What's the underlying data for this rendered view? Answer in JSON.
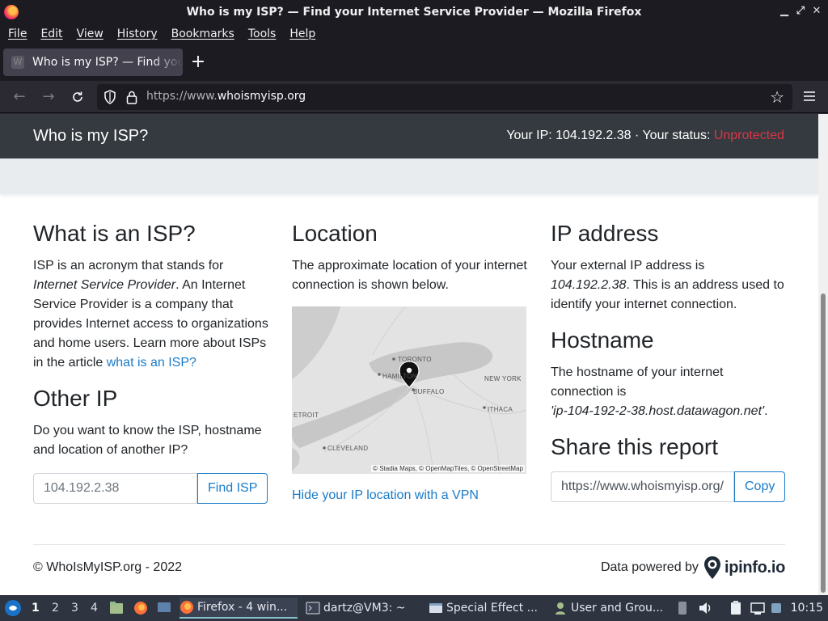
{
  "window": {
    "title": "Who is my ISP? — Find your Internet Service Provider — Mozilla Firefox",
    "controls": [
      "minimize",
      "restore",
      "close"
    ]
  },
  "menubar": {
    "items": [
      "File",
      "Edit",
      "View",
      "History",
      "Bookmarks",
      "Tools",
      "Help"
    ]
  },
  "tabs": [
    {
      "label": "Who is my ISP? — Find your Internet Service Provider",
      "favicon": "W"
    }
  ],
  "newtab_label": "+",
  "navbar": {
    "url_prefix": "https://www.",
    "url_domain": "whoismyisp.org"
  },
  "site": {
    "brand": "Who is my ISP?",
    "status_prefix": "Your IP: 104.192.2.38 · Your status: ",
    "status_value": "Unprotected",
    "status_color": "#dc3545"
  },
  "isp_section": {
    "title": "What is an ISP?",
    "text_a": "ISP is an acronym that stands for ",
    "text_em": "Internet Service Provider",
    "text_b": ". An Internet Service Provider is a company that provides Internet access to organizations and home users. Learn more about ISPs in the article ",
    "link": "what is an ISP?"
  },
  "other_ip": {
    "title": "Other IP",
    "text": "Do you want to know the ISP, hostname and location of another IP?",
    "placeholder": "104.192.2.38",
    "button": "Find ISP"
  },
  "location": {
    "title": "Location",
    "text": "The approximate location of your internet connection is shown below.",
    "map_labels": {
      "toronto": "TORONTO",
      "hamilton": "HAMILTON",
      "buffalo": "BUFFALO",
      "new_york": "NEW YORK",
      "ithaca": "ITHACA",
      "detroit": "ETROIT",
      "cleveland": "CLEVELAND"
    },
    "map_attribution": "© Stadia Maps, © OpenMapTiles, © OpenStreetMap",
    "vpn_link": "Hide your IP location with a VPN"
  },
  "ip_address": {
    "title": "IP address",
    "text_a": "Your external IP address is ",
    "ip": "104.192.2.38",
    "text_b": ". This is an address used to identify your internet connection."
  },
  "hostname": {
    "title": "Hostname",
    "text": "The hostname of your internet connection is",
    "value": "'ip-104-192-2-38.host.datawagon.net'",
    "text_end": "."
  },
  "share": {
    "title": "Share this report",
    "url": "https://www.whoismyisp.org/",
    "button": "Copy"
  },
  "footer": {
    "copyright": "© WhoIsMyISP.org - 2022",
    "powered_by": "Data powered by",
    "provider": "ipinfo.io"
  },
  "taskbar": {
    "workspaces": [
      "1",
      "2",
      "3",
      "4"
    ],
    "active_workspace": "1",
    "tasks": [
      {
        "label": "Firefox - 4 win...",
        "icon": "firefox-icon",
        "active": true
      },
      {
        "label": "dartz@VM3: ~",
        "icon": "terminal-icon",
        "active": false
      },
      {
        "label": "Special Effect ...",
        "icon": "window-icon",
        "active": false
      },
      {
        "label": "User and Grou...",
        "icon": "users-icon",
        "active": false
      }
    ],
    "clock": "10:15"
  }
}
